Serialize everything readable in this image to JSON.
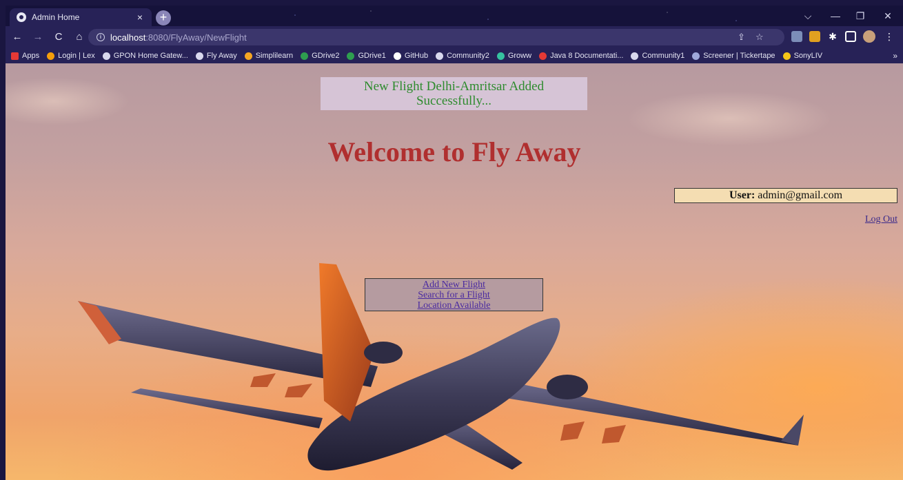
{
  "browser": {
    "tab": {
      "title": "Admin Home",
      "close": "×"
    },
    "new_tab": "+",
    "window_controls": {
      "tabsearch": "⌵",
      "minimize": "—",
      "restore": "❐",
      "close": "✕"
    },
    "address": {
      "host": "localhost",
      "path": ":8080/FlyAway/NewFlight"
    },
    "bookmarks": [
      {
        "label": "Apps",
        "color": "#e53935"
      },
      {
        "label": "Login | Lex",
        "color": "#f59e0b"
      },
      {
        "label": "GPON Home Gatew...",
        "color": "#d8d8ee"
      },
      {
        "label": "Fly Away",
        "color": "#d8d8ee"
      },
      {
        "label": "Simplilearn",
        "color": "#f5a623"
      },
      {
        "label": "GDrive2",
        "color": "#2e9e4f"
      },
      {
        "label": "GDrive1",
        "color": "#2e9e4f"
      },
      {
        "label": "GitHub",
        "color": "#ffffff"
      },
      {
        "label": "Community2",
        "color": "#d8d8ee"
      },
      {
        "label": "Groww",
        "color": "#36c2a0"
      },
      {
        "label": "Java 8 Documentati...",
        "color": "#e53935"
      },
      {
        "label": "Community1",
        "color": "#d8d8ee"
      },
      {
        "label": "Screener | Tickertape",
        "color": "#9fa8da"
      },
      {
        "label": "SonyLIV",
        "color": "#f5c518"
      }
    ],
    "bookmarks_more": "»"
  },
  "page": {
    "success_message_line1": "New Flight Delhi-Amritsar Added",
    "success_message_line2": "Successfully...",
    "title": "Welcome to Fly Away",
    "user_label": "User:",
    "user_email": "admin@gmail.com",
    "logout": "Log Out",
    "menu": {
      "add_flight": "Add New Flight",
      "search_flight": "Search for a Flight",
      "locations": "Location Available"
    }
  },
  "colors": {
    "success_text": "#2e8b2e",
    "title": "#b02f2f",
    "link": "#4a2aa0",
    "user_box_bg": "#f4ddb2"
  }
}
